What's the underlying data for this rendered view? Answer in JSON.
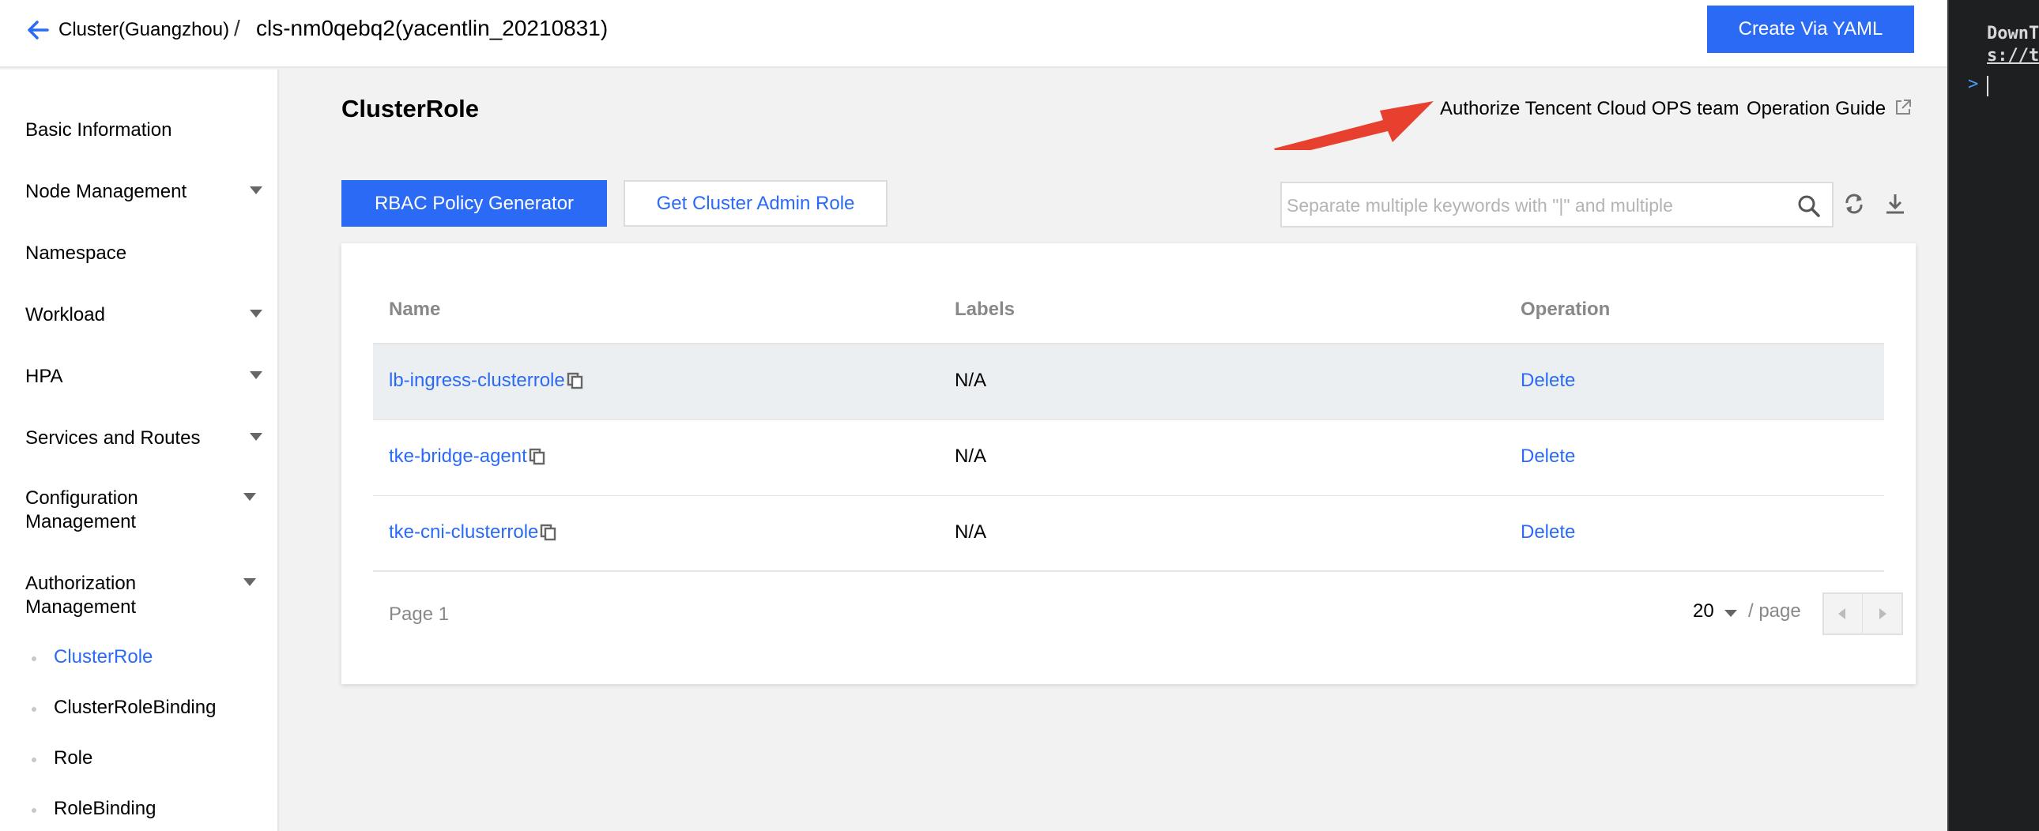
{
  "header": {
    "breadcrumb_parent": "Cluster(Guangzhou)",
    "breadcrumb_sep": "/",
    "breadcrumb_current": "cls-nm0qebq2(yacentlin_20210831)",
    "create_yaml_label": "Create Via YAML"
  },
  "sidebar": {
    "items": [
      {
        "label": "Basic Information"
      },
      {
        "label": "Node Management"
      },
      {
        "label": "Namespace"
      },
      {
        "label": "Workload"
      },
      {
        "label": "HPA"
      },
      {
        "label": "Services and Routes"
      },
      {
        "label": "Configuration Management"
      },
      {
        "label": "Authorization Management"
      }
    ],
    "sub_items": [
      {
        "label": "ClusterRole"
      },
      {
        "label": "ClusterRoleBinding"
      },
      {
        "label": "Role"
      },
      {
        "label": "RoleBinding"
      }
    ]
  },
  "main": {
    "title": "ClusterRole",
    "authorize_link": "Authorize Tencent Cloud OPS team",
    "operation_guide": "Operation Guide",
    "rbac_button": "RBAC Policy Generator",
    "admin_role_button": "Get Cluster Admin Role",
    "search_placeholder": "Separate multiple keywords with \"|\" and multiple",
    "table": {
      "headers": [
        "Name",
        "Labels",
        "Operation"
      ],
      "rows": [
        {
          "name": "lb-ingress-clusterrole",
          "labels": "N/A",
          "operation": "Delete"
        },
        {
          "name": "tke-bridge-agent",
          "labels": "N/A",
          "operation": "Delete"
        },
        {
          "name": "tke-cni-clusterrole",
          "labels": "N/A",
          "operation": "Delete"
        }
      ]
    },
    "pagination": {
      "page_info": "Page 1",
      "page_size": "20",
      "per_page_label": "/ page"
    }
  },
  "terminal": {
    "line1": "DownT",
    "line2": "s://t",
    "prompt": ">"
  },
  "colors": {
    "accent": "#2a6af5",
    "annotation_arrow": "#e8402f",
    "terminal_bg": "#1e1f21"
  }
}
